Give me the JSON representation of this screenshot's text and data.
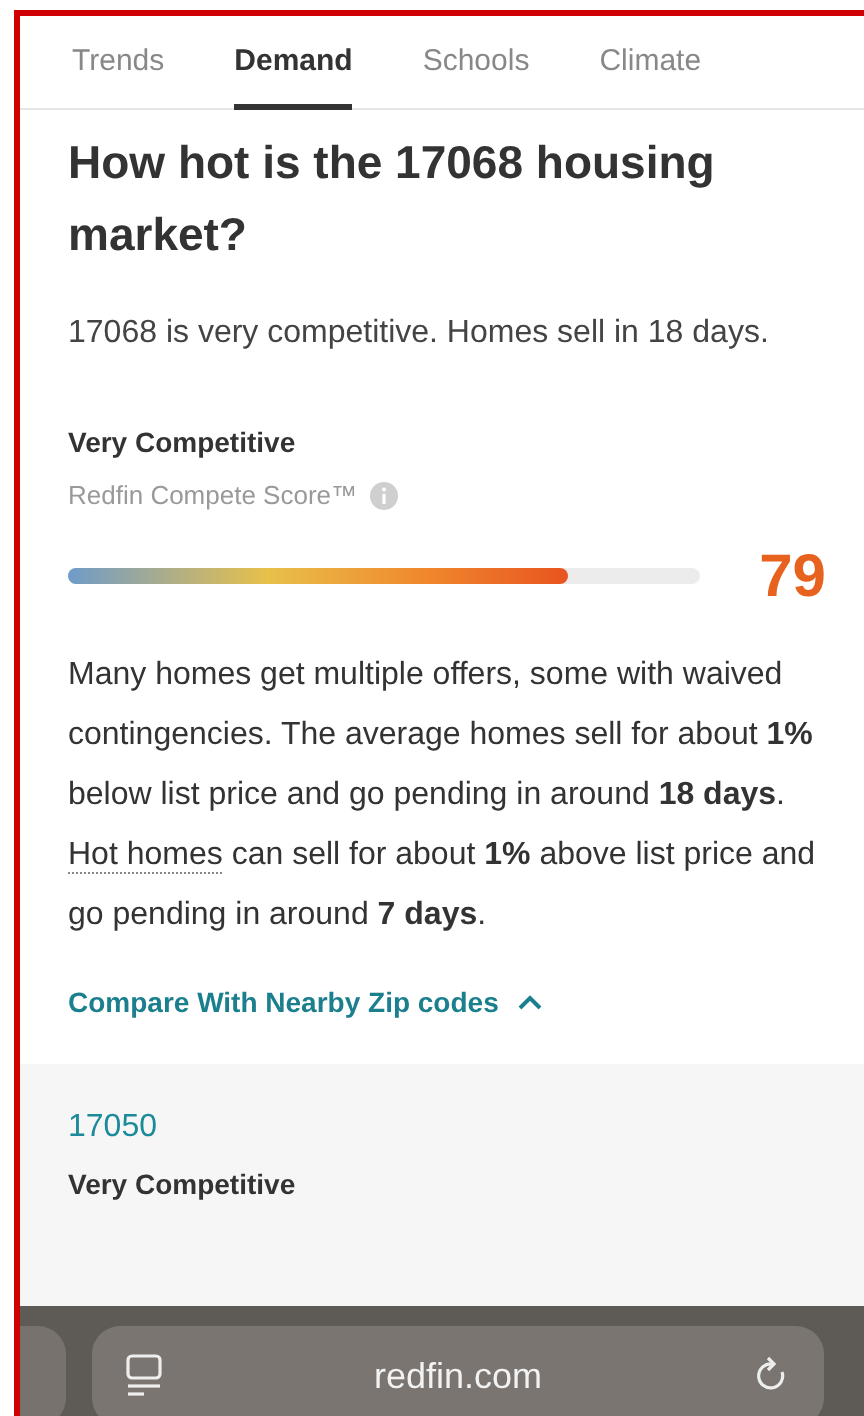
{
  "tabs": [
    {
      "label": "Trends",
      "selected": false
    },
    {
      "label": "Demand",
      "selected": true
    },
    {
      "label": "Schools",
      "selected": false
    },
    {
      "label": "Climate",
      "selected": false
    }
  ],
  "heading": "How hot is the 17068 housing market?",
  "summary": "17068 is very competitive. Homes sell in 18 days.",
  "compete": {
    "rating": "Very Competitive",
    "score_label": "Redfin Compete Score™",
    "level": 0.79,
    "score": "79"
  },
  "description": {
    "before": "Many homes get multiple offers, some with waived contingencies. The average homes sell for about **1%** below list price and go pending in around **18 days**. ",
    "link": "Hot homes",
    "after": " can sell for about **1%** above list price and go pending in around **7 days**."
  },
  "compare_link": {
    "label": "Compare With Nearby Zip codes",
    "expanded": true
  },
  "nearby": [
    {
      "zip": "17050",
      "rating": "Very Competitive"
    }
  ],
  "browser": {
    "url": "redfin.com"
  }
}
